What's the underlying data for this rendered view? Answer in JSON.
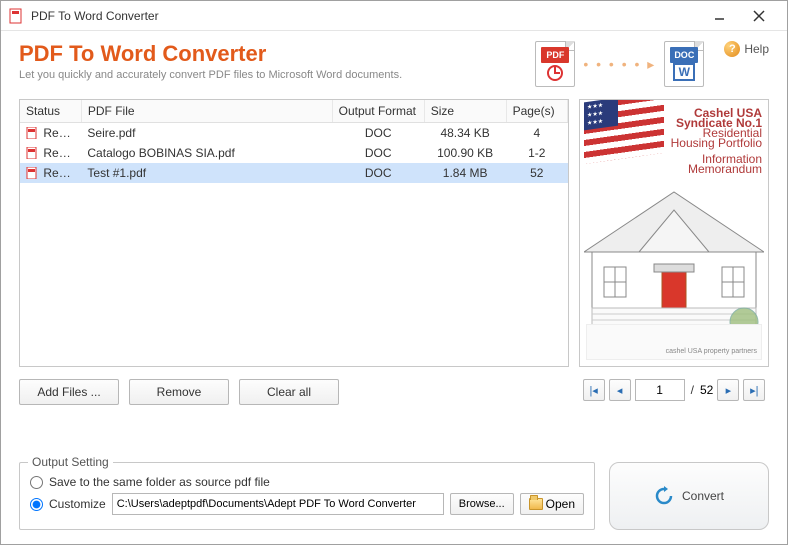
{
  "window": {
    "title": "PDF To Word Converter"
  },
  "header": {
    "title": "PDF To Word Converter",
    "subtitle": "Let you quickly and accurately convert PDF files to Microsoft Word documents.",
    "pdf_badge": "PDF",
    "doc_badge": "DOC",
    "help_label": "Help"
  },
  "table": {
    "headers": {
      "status": "Status",
      "file": "PDF File",
      "format": "Output Format",
      "size": "Size",
      "pages": "Page(s)"
    },
    "rows": [
      {
        "status": "Ready",
        "file": "Seire.pdf",
        "format": "DOC",
        "size": "48.34 KB",
        "pages": "4",
        "selected": false
      },
      {
        "status": "Ready",
        "file": "Catalogo BOBINAS SIA.pdf",
        "format": "DOC",
        "size": "100.90 KB",
        "pages": "1-2",
        "selected": false
      },
      {
        "status": "Ready",
        "file": "Test #1.pdf",
        "format": "DOC",
        "size": "1.84 MB",
        "pages": "52",
        "selected": true
      }
    ]
  },
  "buttons": {
    "add": "Add Files ...",
    "remove": "Remove",
    "clear": "Clear all",
    "browse": "Browse...",
    "open": "Open",
    "convert": "Convert"
  },
  "pager": {
    "current": "1",
    "total": "52",
    "sep": "/"
  },
  "output": {
    "legend": "Output Setting",
    "same_folder_label": "Save to the same folder as source pdf file",
    "customize_label": "Customize",
    "path": "C:\\Users\\adeptpdf\\Documents\\Adept PDF To Word Converter",
    "selected": "customize"
  },
  "preview": {
    "title_line1": "Cashel USA Syndicate No.1",
    "title_line2": "Residential Housing Portfolio",
    "title_line3": "Information Memorandum",
    "footer": "cashel USA property partners"
  }
}
